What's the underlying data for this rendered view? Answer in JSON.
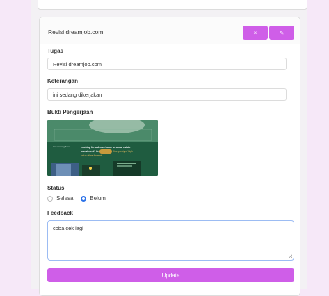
{
  "card": {
    "title": "Revisi dreamjob.com",
    "close_icon": "×",
    "edit_icon": "✎"
  },
  "form": {
    "tugas_label": "Tugas",
    "tugas_value": "Revisi dreamjob.com",
    "keterangan_label": "Keterangan",
    "keterangan_value": "ini sedang dikerjakan",
    "bukti_label": "Bukti Pengerjaan",
    "status_label": "Status",
    "status_options": [
      "Selesai",
      "Belum"
    ],
    "status_selected": "Belum",
    "feedback_label": "Feedback",
    "feedback_value": "coba cek lagi",
    "update_label": "Update"
  },
  "thumbnail": {
    "headline": "Looking for a dream home or a real estate investment? find plenty of high value villas for rent"
  },
  "colors": {
    "accent": "#cf5ee8",
    "background": "#f6e8f8",
    "radio_selected": "#2c72e8"
  }
}
